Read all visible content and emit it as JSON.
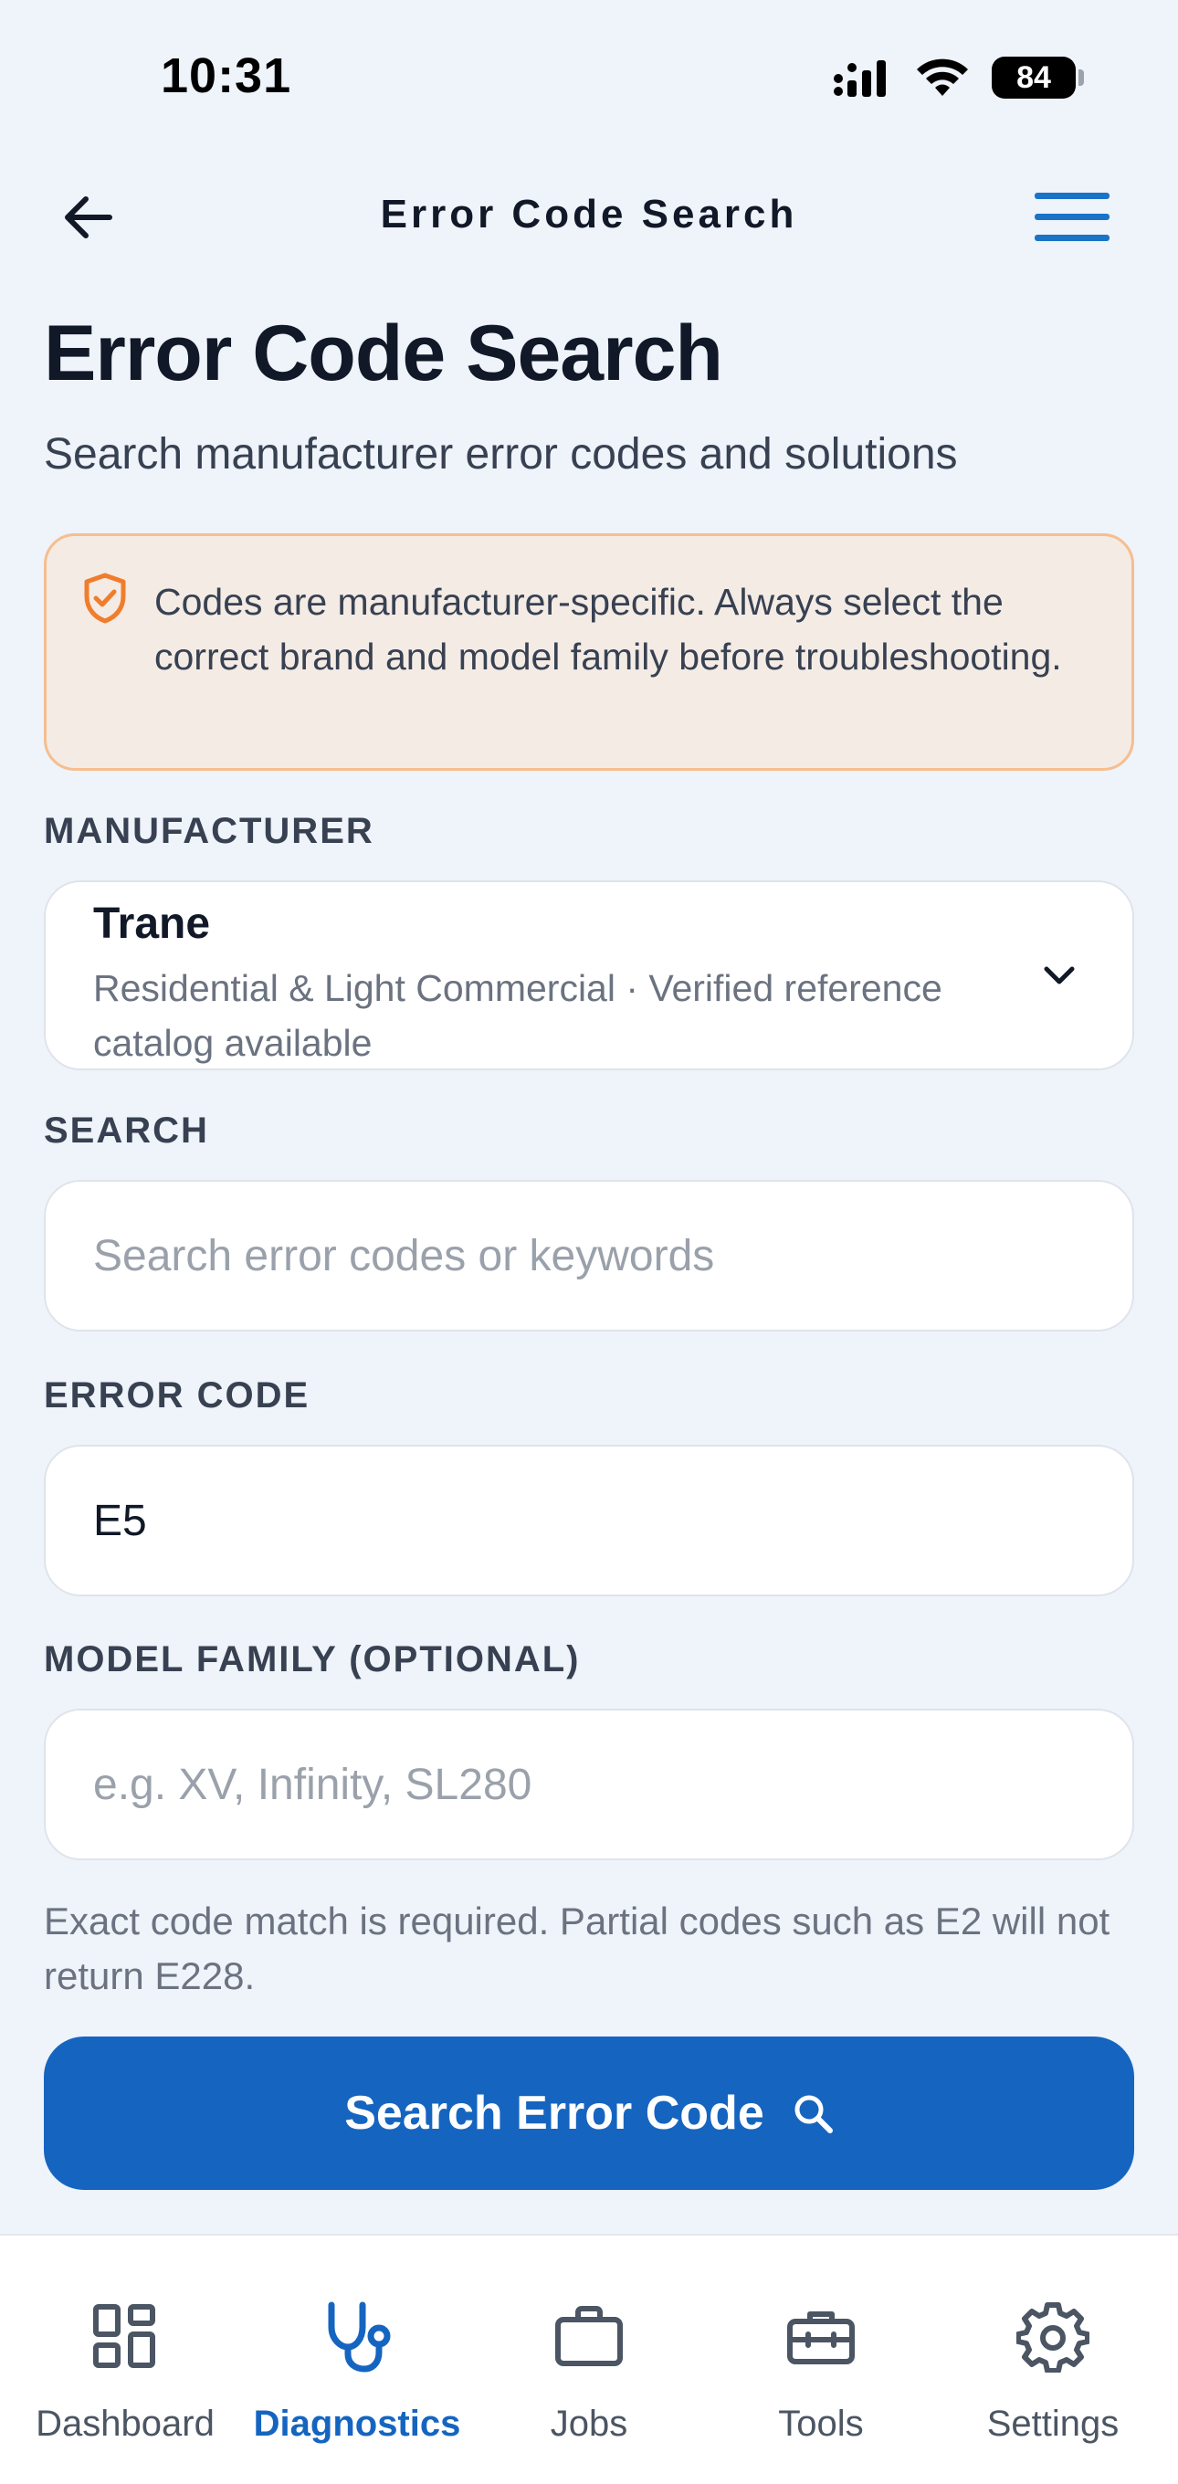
{
  "status_bar": {
    "time": "10:31",
    "battery": "84"
  },
  "nav": {
    "title": "Error Code Search"
  },
  "header": {
    "title": "Error Code Search",
    "subtitle": "Search manufacturer error codes and solutions"
  },
  "notice": {
    "text": "Codes are manufacturer-specific. Always select the correct brand and model family before troubleshooting.",
    "icon": "shield-check-icon",
    "accent_color": "#f07d2c"
  },
  "manufacturer": {
    "label": "MANUFACTURER",
    "value": "Trane",
    "description": "Residential & Light Commercial · Verified reference catalog available"
  },
  "search": {
    "label": "SEARCH",
    "placeholder": "Search error codes or keywords",
    "value": ""
  },
  "error_code": {
    "label": "ERROR CODE",
    "value": "E5"
  },
  "model_family": {
    "label": "MODEL FAMILY (OPTIONAL)",
    "placeholder": "e.g. XV, Infinity, SL280",
    "value": ""
  },
  "helper_text": "Exact code match is required. Partial codes such as E2 will not return E228.",
  "primary_button": {
    "label": "Search Error Code",
    "icon": "search-icon",
    "color": "#1565c0"
  },
  "tabs": [
    {
      "label": "Dashboard",
      "icon": "dashboard-icon"
    },
    {
      "label": "Diagnostics",
      "icon": "stethoscope-icon",
      "active": true
    },
    {
      "label": "Jobs",
      "icon": "briefcase-icon"
    },
    {
      "label": "Tools",
      "icon": "toolbox-icon"
    },
    {
      "label": "Settings",
      "icon": "gear-icon"
    }
  ]
}
